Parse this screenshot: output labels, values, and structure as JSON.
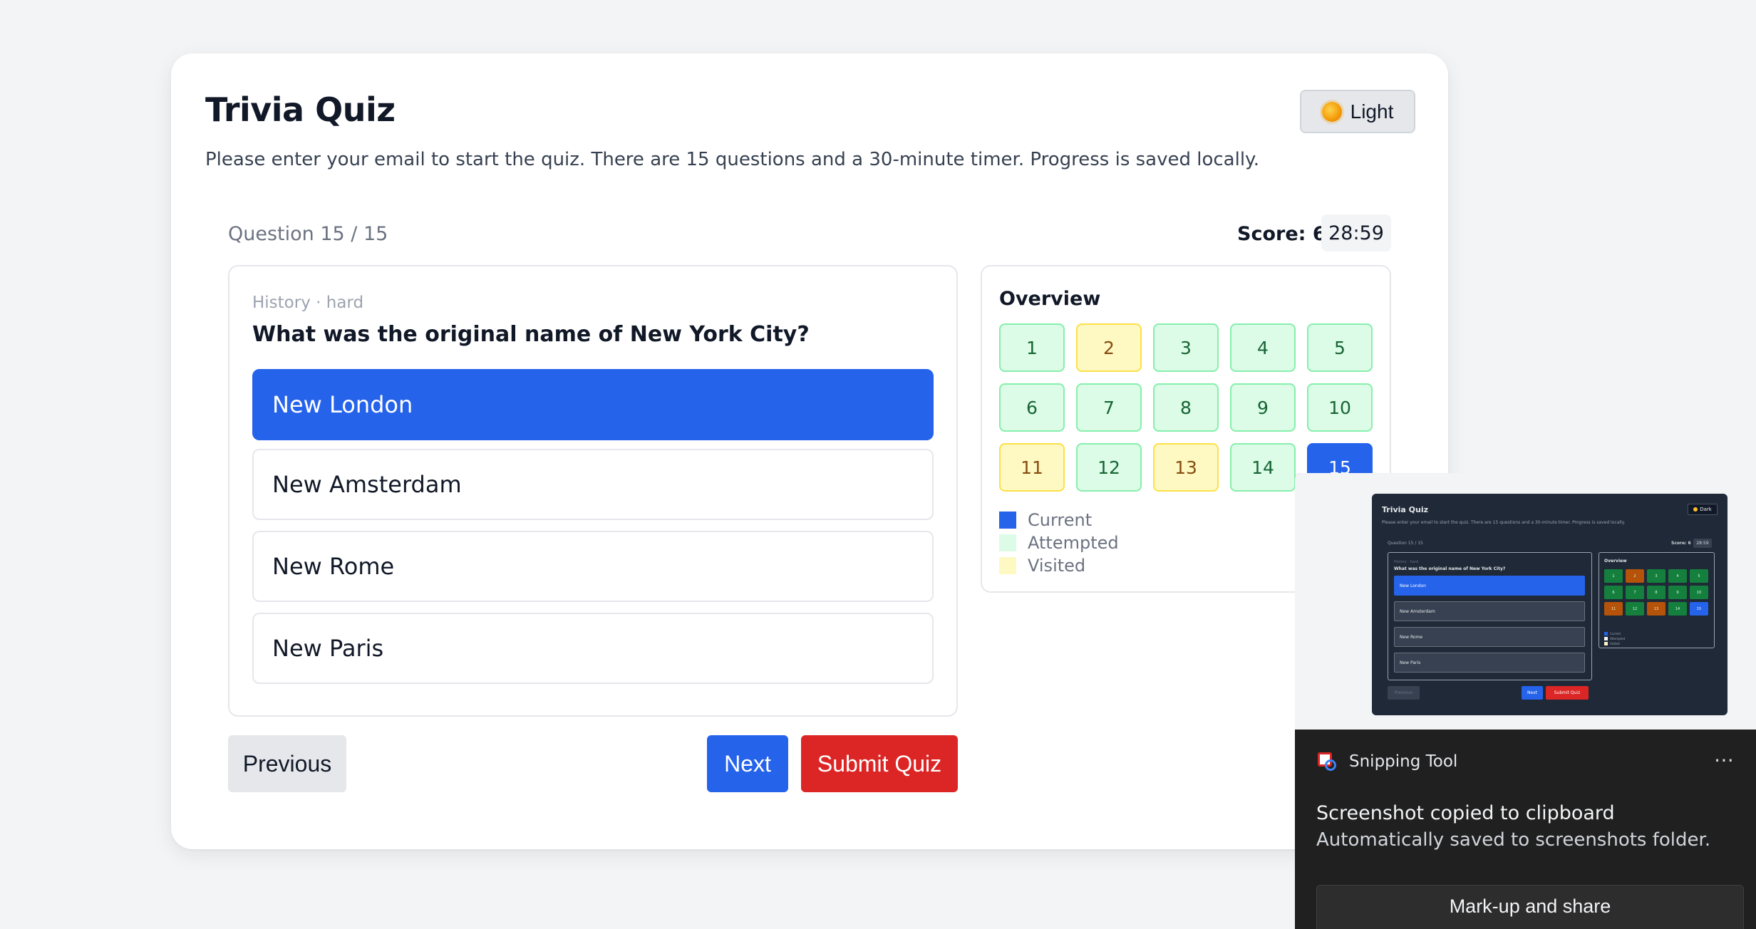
{
  "app": {
    "title": "Trivia Quiz",
    "subtitle": "Please enter your email to start the quiz. There are 15 questions and a 30-minute timer. Progress is saved locally.",
    "theme_label": "Light"
  },
  "status": {
    "question_counter": "Question 15 / 15",
    "score": "Score: 6",
    "timer": "28:59"
  },
  "question": {
    "meta": "History · hard",
    "text": "What was the original name of New York City?",
    "options": [
      {
        "label": "New London",
        "selected": true
      },
      {
        "label": "New Amsterdam",
        "selected": false
      },
      {
        "label": "New Rome",
        "selected": false
      },
      {
        "label": "New Paris",
        "selected": false
      }
    ]
  },
  "overview": {
    "title": "Overview",
    "cells": [
      {
        "label": "1",
        "state": "attempted"
      },
      {
        "label": "2",
        "state": "visited"
      },
      {
        "label": "3",
        "state": "attempted"
      },
      {
        "label": "4",
        "state": "attempted"
      },
      {
        "label": "5",
        "state": "attempted"
      },
      {
        "label": "6",
        "state": "attempted"
      },
      {
        "label": "7",
        "state": "attempted"
      },
      {
        "label": "8",
        "state": "attempted"
      },
      {
        "label": "9",
        "state": "attempted"
      },
      {
        "label": "10",
        "state": "attempted"
      },
      {
        "label": "11",
        "state": "visited"
      },
      {
        "label": "12",
        "state": "attempted"
      },
      {
        "label": "13",
        "state": "visited"
      },
      {
        "label": "14",
        "state": "attempted"
      },
      {
        "label": "15",
        "state": "current"
      }
    ],
    "legend": [
      {
        "label": "Current",
        "color": "#2563eb"
      },
      {
        "label": "Attempted",
        "color": "#dcfce7"
      },
      {
        "label": "Visited",
        "color": "#fef9c3"
      }
    ]
  },
  "footer": {
    "previous_label": "Previous",
    "next_label": "Next",
    "submit_label": "Submit Quiz"
  },
  "notification": {
    "app_name": "Snipping Tool",
    "more_icon": "⋯",
    "title": "Screenshot copied to clipboard",
    "body": "Automatically saved to screenshots folder.",
    "action_label": "Mark-up and share"
  },
  "thumbnail": {
    "title": "Trivia Quiz",
    "subtitle": "Please enter your email to start the quiz. There are 15 questions and a 30-minute timer. Progress is saved locally.",
    "theme_label": "Dark",
    "question_counter": "Question 15 / 15",
    "score": "Score: 6",
    "timer": "28:59",
    "meta": "History · hard",
    "question": "What was the original name of New York City?",
    "options": [
      "New London",
      "New Amsterdam",
      "New Rome",
      "New Paris"
    ],
    "overview_title": "Overview",
    "legend": [
      "Current",
      "Attempted",
      "Visited"
    ],
    "previous_label": "Previous",
    "next_label": "Next",
    "submit_label": "Submit Quiz"
  },
  "colors": {
    "accent": "#2563eb",
    "danger": "#dc2626",
    "attempted": "#dcfce7",
    "visited": "#fef9c3"
  }
}
